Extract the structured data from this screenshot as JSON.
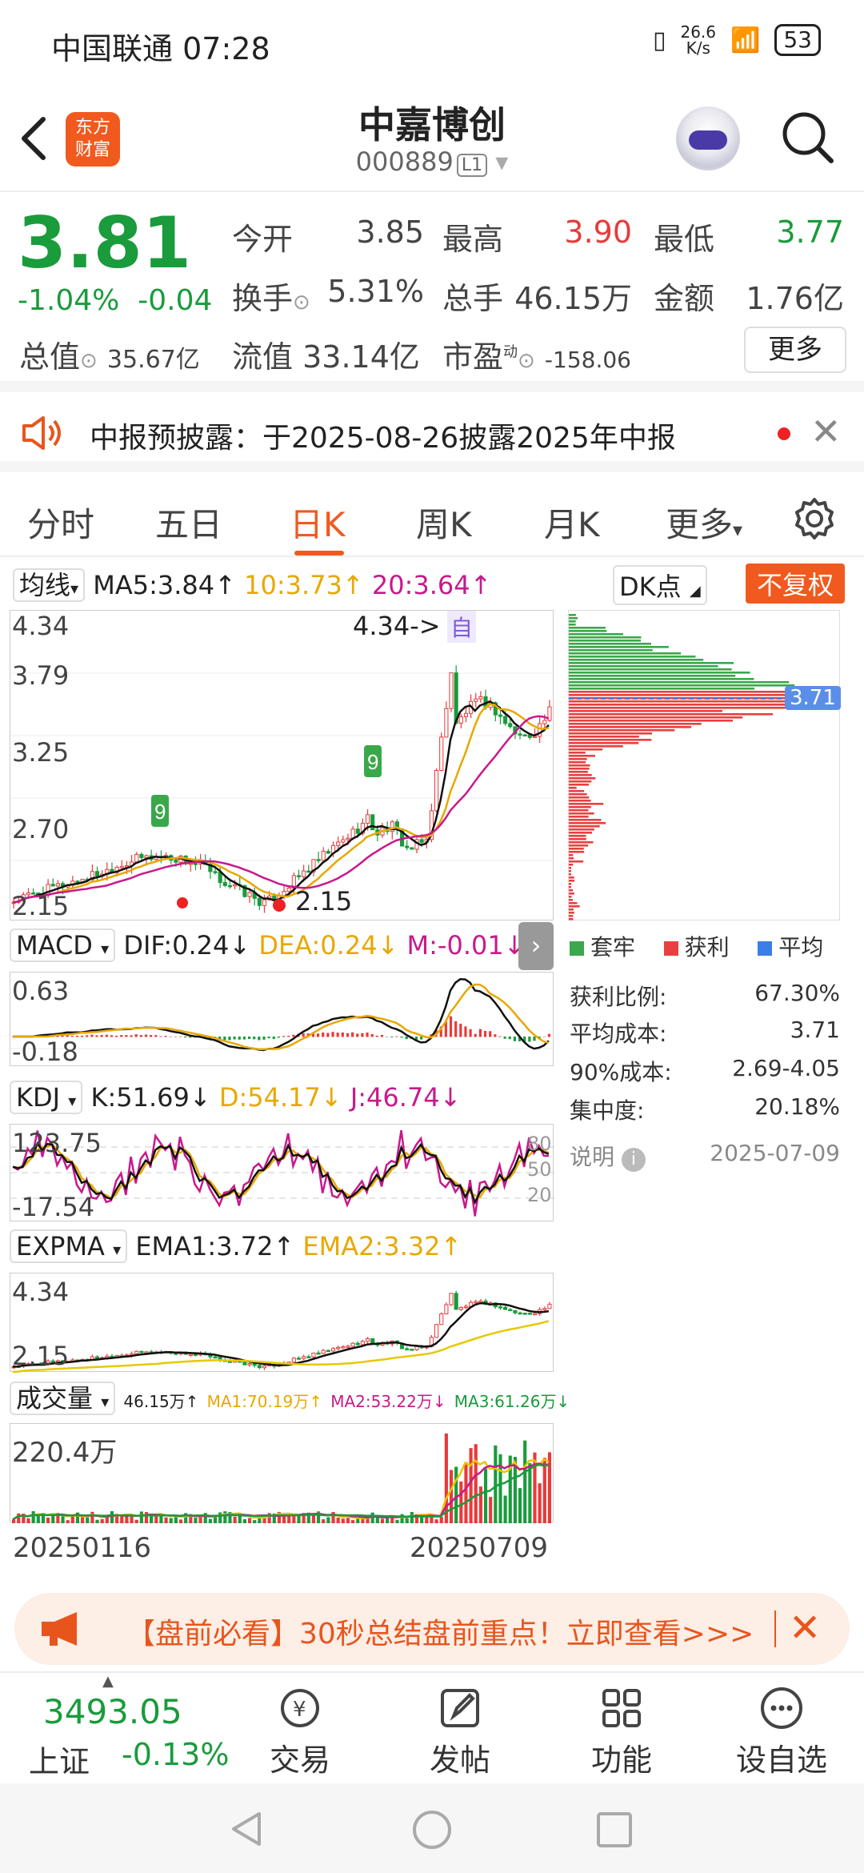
{
  "status_bar": {
    "carrier": "中国联通",
    "time": "07:28",
    "net_speed_top": "26.6",
    "net_speed_bottom": "K/s",
    "battery": "53"
  },
  "header": {
    "logo_line1": "东方",
    "logo_line2": "财富",
    "stock_name": "中嘉博创",
    "stock_code": "000889",
    "market_tag": "L1"
  },
  "quote": {
    "price": "3.81",
    "change_pct": "-1.04%",
    "change_abs": "-0.04",
    "rows": [
      [
        {
          "label": "今开",
          "value": "3.85"
        },
        {
          "label": "最高",
          "value": "3.90"
        },
        {
          "label": "最低",
          "value": "3.77"
        }
      ],
      [
        {
          "label": "换手",
          "value": "5.31%"
        },
        {
          "label": "总手",
          "value": "46.15万"
        },
        {
          "label": "金额",
          "value": "1.76亿"
        }
      ]
    ],
    "total_value_label": "总值",
    "total_value": "35.67亿",
    "float_value_label": "流值",
    "float_value": "33.14亿",
    "pe_label": "市盈",
    "pe_sup": "动",
    "pe_value": "-158.06",
    "more_button": "更多"
  },
  "notice": {
    "text": "中报预披露：于2025-08-26披露2025年中报"
  },
  "tabs": {
    "items": [
      "分时",
      "五日",
      "日K",
      "周K",
      "月K",
      "更多"
    ],
    "active": "日K"
  },
  "indicators": {
    "ma": {
      "selector": "均线",
      "ma5": "MA5:3.84↑",
      "ma10": "10:3.73↑",
      "ma20": "20:3.64↑"
    },
    "dk": "DK点",
    "restore": "不复权",
    "kline": {
      "max": "4.34",
      "t2": "3.79",
      "t3": "3.25",
      "t4": "2.70",
      "min": "2.15",
      "high_marker": "4.34->",
      "self_tag": "自",
      "low_marker": "2.15"
    },
    "macd": {
      "selector": "MACD",
      "dif": "DIF:0.24↓",
      "dea": "DEA:0.24↓",
      "m": "M:-0.01↓",
      "top": "0.63",
      "bottom": "-0.18"
    },
    "kdj": {
      "selector": "KDJ",
      "k": "K:51.69↓",
      "d": "D:54.17↓",
      "j": "J:46.74↓",
      "top": "123.75",
      "bottom": "-17.54",
      "r80": "80",
      "r50": "50",
      "r20": "20"
    },
    "expma": {
      "selector": "EXPMA",
      "ema1": "EMA1:3.72↑",
      "ema2": "EMA2:3.32↑",
      "top": "4.34",
      "bottom": "2.15"
    },
    "volume": {
      "selector": "成交量",
      "v": "46.15万↑",
      "ma1": "MA1:70.19万↑",
      "ma2": "MA2:53.22万↓",
      "ma3": "MA3:61.26万↓",
      "top": "220.4万"
    },
    "dates": {
      "start": "20250116",
      "end": "20250709"
    }
  },
  "chip": {
    "avg_tag": "3.71",
    "legend": [
      {
        "label": "套牢",
        "color": "#3aa84a"
      },
      {
        "label": "获利",
        "color": "#e84040"
      },
      {
        "label": "平均",
        "color": "#3a7ee8"
      }
    ],
    "stats": [
      {
        "label": "获利比例:",
        "value": "67.30%"
      },
      {
        "label": "平均成本:",
        "value": "3.71"
      },
      {
        "label": "90%成本:",
        "value": "2.69-4.05"
      },
      {
        "label": "集中度:",
        "value": "20.18%"
      }
    ],
    "note_label": "说明",
    "date": "2025-07-09"
  },
  "banner": {
    "text": "【盘前必看】30秒总结盘前重点！立即查看>>>"
  },
  "bottom_nav": {
    "index_value": "3493.05",
    "index_name": "上证",
    "index_change": "-0.13%",
    "items": [
      "交易",
      "发帖",
      "功能",
      "设自选"
    ]
  },
  "colors": {
    "up": "#e83a3a",
    "down": "#1a9b3c",
    "accent": "#f05a1e",
    "ma10": "#e8a800",
    "ma20": "#c8198c"
  }
}
